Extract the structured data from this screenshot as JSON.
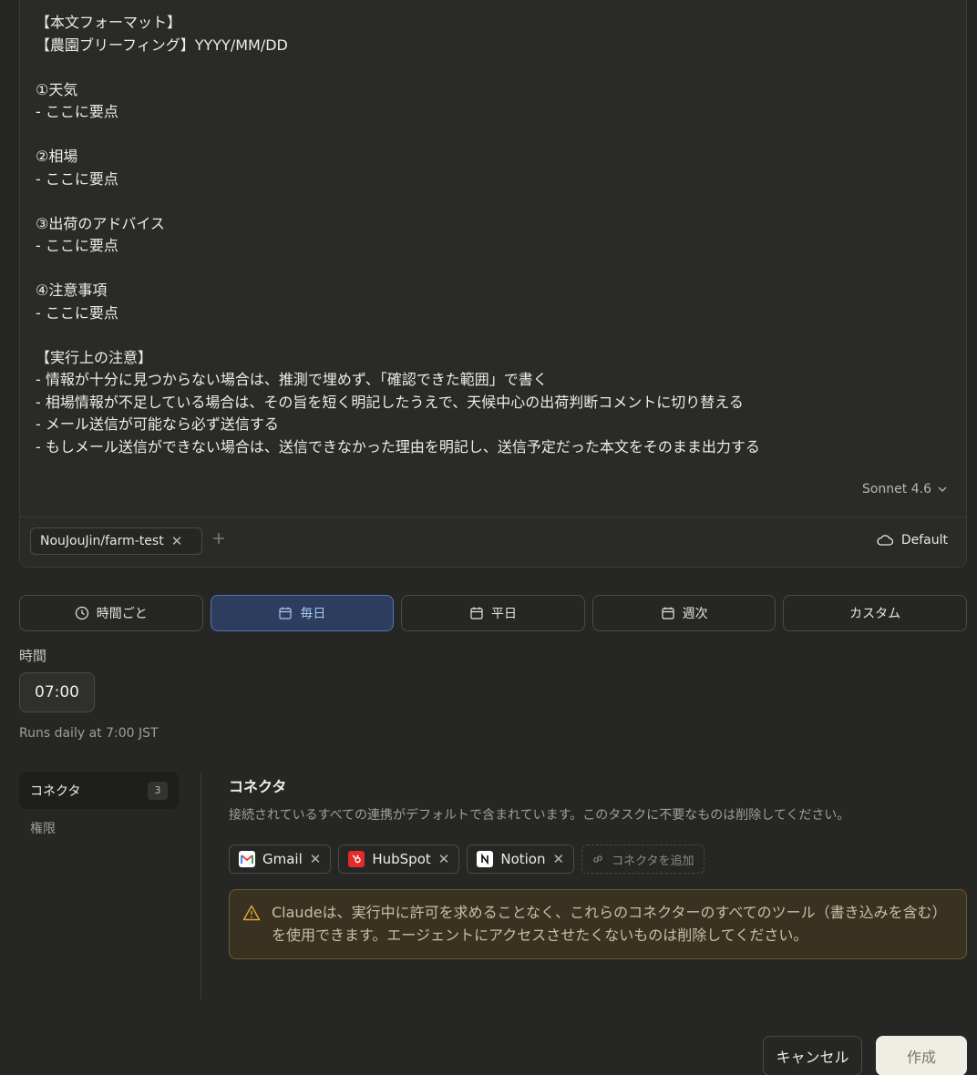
{
  "prompt": {
    "text": "【本文フォーマット】\n【農園ブリーフィング】YYYY/MM/DD\n\n①天気\n- ここに要点\n\n②相場\n- ここに要点\n\n③出荷のアドバイス\n- ここに要点\n\n④注意事項\n- ここに要点\n\n【実行上の注意】\n- 情報が十分に見つからない場合は、推測で埋めず、「確認できた範囲」で書く\n- 相場情報が不足している場合は、その旨を短く明記したうえで、天候中心の出荷判断コメントに切り替える\n- メール送信が可能なら必ず送信する\n- もしメール送信ができない場合は、送信できなかった理由を明記し、送信予定だった本文をそのまま出力する",
    "model": "Sonnet 4.6",
    "repo": "NouJouJin/farm-test",
    "environment": "Default"
  },
  "frequency": {
    "options": [
      "時間ごと",
      "毎日",
      "平日",
      "週次",
      "カスタム"
    ],
    "selected": "毎日"
  },
  "time": {
    "label": "時間",
    "value": "07:00",
    "summary": "Runs daily at 7:00 JST"
  },
  "sidebar": {
    "items": [
      {
        "label": "コネクタ",
        "count": "3"
      },
      {
        "label": "権限"
      }
    ]
  },
  "connectors": {
    "title": "コネクタ",
    "description": "接続されているすべての連携がデフォルトで含まれています。このタスクに不要なものは削除してください。",
    "items": [
      "Gmail",
      "HubSpot",
      "Notion"
    ],
    "add_label": "コネクタを追加",
    "warning": "Claudeは、実行中に許可を求めることなく、これらのコネクターのすべてのツール（書き込みを含む）を使用できます。エージェントにアクセスさせたくないものは削除してください。"
  },
  "footer": {
    "cancel": "キャンセル",
    "create": "作成"
  },
  "colors": {
    "background": "#262624",
    "accent": "#4f74b8",
    "warning": "#e0a93a"
  }
}
